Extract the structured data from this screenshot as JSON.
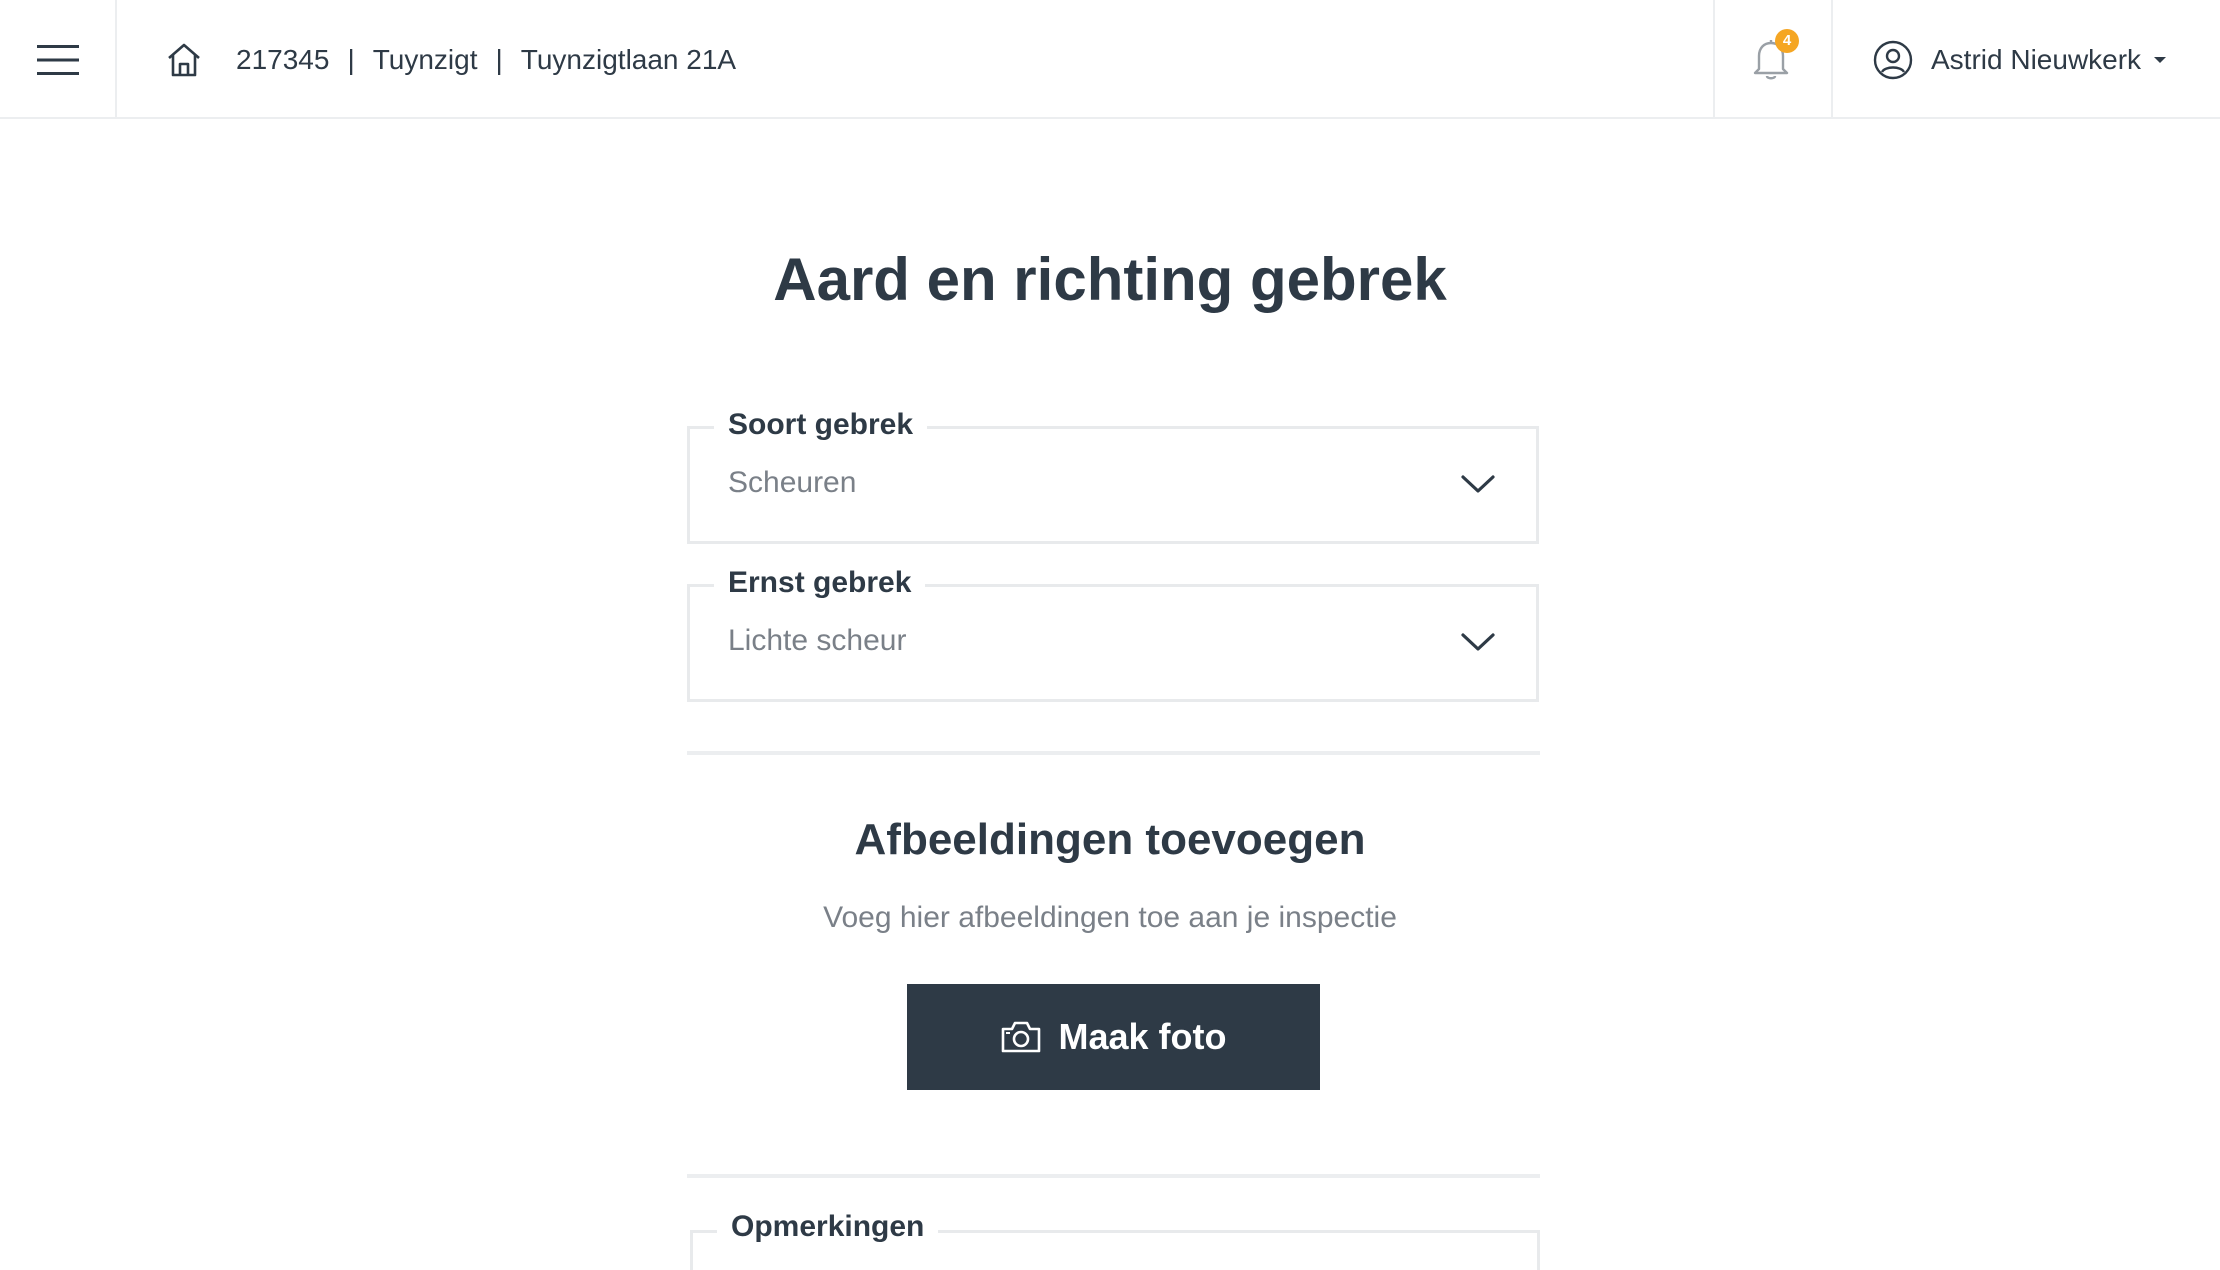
{
  "header": {
    "breadcrumb": {
      "id": "217345",
      "project": "Tuynzigt",
      "address": "Tuynzigtlaan 21A",
      "separator": "|"
    },
    "notifications": {
      "count": "4"
    },
    "user": {
      "name": "Astrid Nieuwkerk"
    }
  },
  "main": {
    "title": "Aard en richting gebrek",
    "fields": [
      {
        "label": "Soort gebrek",
        "value": "Scheuren"
      },
      {
        "label": "Ernst gebrek",
        "value": "Lichte scheur"
      }
    ],
    "images_section": {
      "title": "Afbeeldingen toevoegen",
      "subtitle": "Voeg hier afbeeldingen toe aan je inspectie",
      "button_label": "Maak foto"
    },
    "remarks": {
      "label": "Opmerkingen"
    }
  },
  "colors": {
    "primary_dark": "#2e3a46",
    "badge": "#f5a623",
    "border": "#e8eaec",
    "muted_text": "#7a8088"
  },
  "icons": [
    "hamburger-menu-icon",
    "home-icon",
    "bell-icon",
    "user-circle-icon",
    "caret-down-icon",
    "chevron-down-icon",
    "camera-icon"
  ]
}
